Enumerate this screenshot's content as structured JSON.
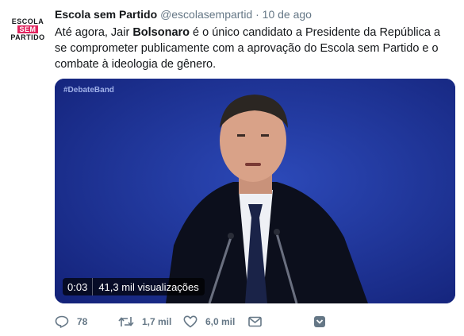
{
  "account": {
    "avatar_line1": "ESCOLA",
    "avatar_line2": "SEM",
    "avatar_line3": "PARTIDO",
    "display_name": "Escola sem Partido",
    "handle": "@escolasempartid",
    "separator": "·",
    "date": "10 de ago"
  },
  "tweet": {
    "text_before": "Até agora, Jair ",
    "text_bold": "Bolsonaro",
    "text_after": " é o único candidato a Presidente da República a se comprometer publicamente com a aprovação do Escola sem Partido e o combate à ideologia de gênero."
  },
  "video": {
    "hashtag": "#DebateBand",
    "time": "0:03",
    "views": "41,3 mil visualizações"
  },
  "actions": {
    "reply_count": "78",
    "retweet_count": "1,7 mil",
    "like_count": "6,0 mil"
  },
  "colors": {
    "accent": "#e0245e",
    "muted": "#657786",
    "video_bg": "#1a2f86"
  }
}
